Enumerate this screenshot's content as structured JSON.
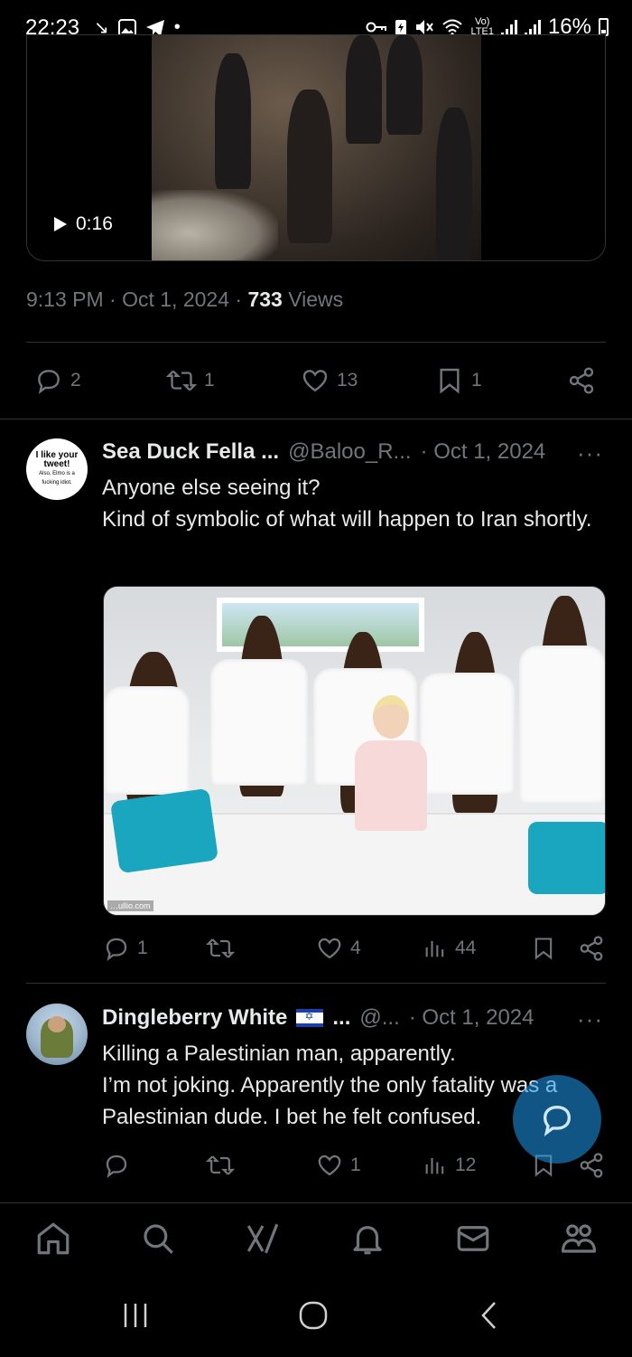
{
  "status_bar": {
    "time": "22:23",
    "lte_label_top": "Vo)",
    "lte_label_bottom": "LTE1",
    "battery": "16%"
  },
  "video_tweet": {
    "duration": "0:16",
    "timestamp": "9:13 PM · Oct 1, 2024 · ",
    "views_count": "733",
    "views_label": " Views",
    "replies": "2",
    "reposts": "1",
    "likes": "13",
    "bookmarks": "1"
  },
  "reply1": {
    "avatar_line1": "I like your tweet!",
    "avatar_line2": "Also, Elmo is a fucking idiot.",
    "name": "Sea Duck Fella ...",
    "handle": "@Baloo_R...",
    "date": "· Oct 1, 2024",
    "more": "···",
    "text": "Anyone else seeing it?\nKind of symbolic of what will happen to Iran shortly.",
    "image_watermark": "…ullio.com",
    "replies": "1",
    "reposts": "",
    "likes": "4",
    "views": "44"
  },
  "reply2": {
    "name": "Dingleberry White",
    "name_suffix": "...",
    "handle": "@...",
    "date": "· Oct 1, 2024",
    "more": "···",
    "text": "Killing a Palestinian man, apparently.\nI’m not joking. Apparently the only fatality was a Palestinian dude. I bet he felt confused.",
    "replies": "",
    "reposts": "",
    "likes": "1",
    "views": "12"
  },
  "icons": [
    "home-icon",
    "search-icon",
    "grok-icon",
    "notifications-icon",
    "messages-icon",
    "communities-icon"
  ],
  "colors": {
    "background": "#000000",
    "text": "#e7e9ea",
    "muted": "#71767b",
    "divider": "#2f3336",
    "accent": "#1d9bf0"
  }
}
